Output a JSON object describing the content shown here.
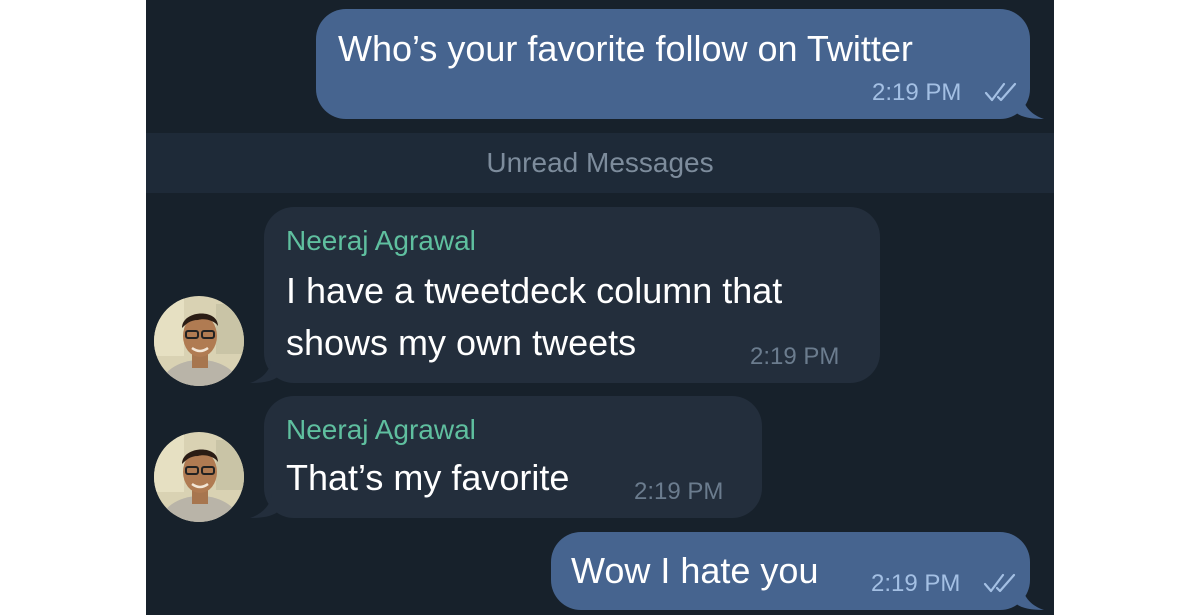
{
  "messages": [
    {
      "id": "m1",
      "direction": "out",
      "text": "Who’s your favorite follow on Twitter",
      "time": "2:19 PM",
      "read": true
    },
    {
      "id": "m2",
      "direction": "in",
      "sender": "Neeraj Agrawal",
      "text_lines": [
        "I have a tweetdeck column that",
        "shows my own tweets"
      ],
      "time": "2:19 PM"
    },
    {
      "id": "m3",
      "direction": "in",
      "sender": "Neeraj Agrawal",
      "text": "That’s my favorite",
      "time": "2:19 PM"
    },
    {
      "id": "m4",
      "direction": "out",
      "text": "Wow I hate you",
      "time": "2:19 PM",
      "read": true
    }
  ],
  "divider": {
    "label": "Unread Messages"
  },
  "colors": {
    "background": "#17212b",
    "outgoing_bubble": "#46648f",
    "incoming_bubble": "#232e3c",
    "sender_name": "#5fbf9f",
    "read_ticks": "#a4c0e4"
  },
  "icons": {
    "read_status": "double-check-icon",
    "avatar": "user-avatar"
  }
}
